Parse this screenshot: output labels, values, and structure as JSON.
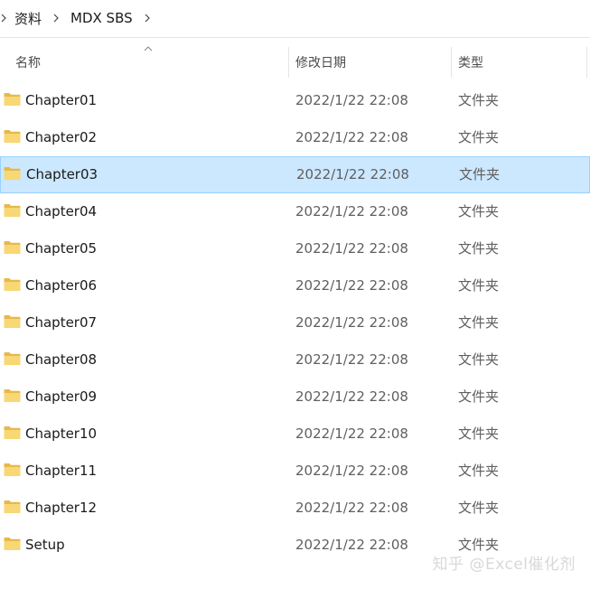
{
  "breadcrumb": {
    "items": [
      "资料",
      "MDX SBS"
    ]
  },
  "columns": {
    "name": "名称",
    "date": "修改日期",
    "type": "类型"
  },
  "rows": [
    {
      "name": "Chapter01",
      "date": "2022/1/22 22:08",
      "type": "文件夹"
    },
    {
      "name": "Chapter02",
      "date": "2022/1/22 22:08",
      "type": "文件夹"
    },
    {
      "name": "Chapter03",
      "date": "2022/1/22 22:08",
      "type": "文件夹"
    },
    {
      "name": "Chapter04",
      "date": "2022/1/22 22:08",
      "type": "文件夹"
    },
    {
      "name": "Chapter05",
      "date": "2022/1/22 22:08",
      "type": "文件夹"
    },
    {
      "name": "Chapter06",
      "date": "2022/1/22 22:08",
      "type": "文件夹"
    },
    {
      "name": "Chapter07",
      "date": "2022/1/22 22:08",
      "type": "文件夹"
    },
    {
      "name": "Chapter08",
      "date": "2022/1/22 22:08",
      "type": "文件夹"
    },
    {
      "name": "Chapter09",
      "date": "2022/1/22 22:08",
      "type": "文件夹"
    },
    {
      "name": "Chapter10",
      "date": "2022/1/22 22:08",
      "type": "文件夹"
    },
    {
      "name": "Chapter11",
      "date": "2022/1/22 22:08",
      "type": "文件夹"
    },
    {
      "name": "Chapter12",
      "date": "2022/1/22 22:08",
      "type": "文件夹"
    },
    {
      "name": "Setup",
      "date": "2022/1/22 22:08",
      "type": "文件夹"
    }
  ],
  "selected_row": "Chapter03",
  "watermark": "知乎 @Excel催化剂",
  "icons": {
    "folder": "folder-icon",
    "separator": "chevron-right-icon",
    "sort": "sort-up-icon"
  },
  "colors": {
    "selection_bg": "#cce8ff",
    "selection_border": "#99d1ff",
    "folder_yellow": "#f8d775"
  }
}
